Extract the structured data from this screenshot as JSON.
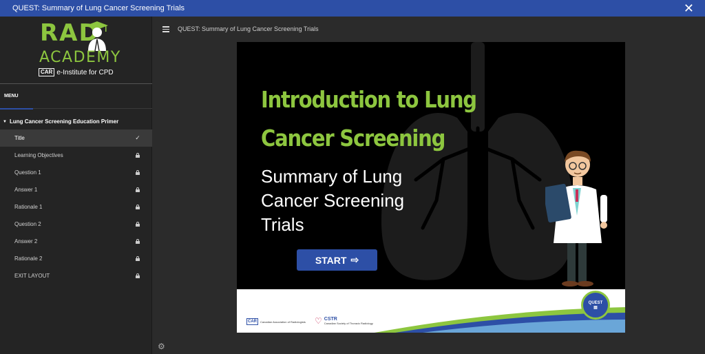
{
  "window": {
    "title": "QUEST: Summary of Lung Cancer Screening Trials"
  },
  "logo": {
    "line1": "RAD",
    "line2": "ACADEMY",
    "tag_box": "CAR",
    "tagline": "e-Institute for CPD"
  },
  "sidebar": {
    "menu_label": "MENU",
    "section_title": "Lung Cancer Screening Education Primer",
    "items": [
      {
        "label": "Title",
        "status": "completed"
      },
      {
        "label": "Learning Objectives",
        "status": "locked"
      },
      {
        "label": "Question 1",
        "status": "locked"
      },
      {
        "label": "Answer 1",
        "status": "locked"
      },
      {
        "label": "Rationale 1",
        "status": "locked"
      },
      {
        "label": "Question 2",
        "status": "locked"
      },
      {
        "label": "Answer 2",
        "status": "locked"
      },
      {
        "label": "Rationale 2",
        "status": "locked"
      },
      {
        "label": "EXIT LAYOUT",
        "status": "locked"
      }
    ],
    "check_glyph": "✓"
  },
  "topbar": {
    "breadcrumb": "QUEST: Summary of Lung Cancer Screening Trials"
  },
  "slide": {
    "heading": "Introduction to Lung Cancer Screening",
    "subheading": "Summary of Lung Cancer Screening Trials",
    "start_label": "START",
    "start_arrow": "⇨",
    "footer": {
      "car_box": "CAR",
      "car_text": "Canadian Association of Radiologists",
      "cstr_name": "CSTR",
      "cstr_text": "Canadian Society of Thoracic Radiology",
      "badge_text": "QUEST"
    }
  },
  "colors": {
    "accent_blue": "#2d4fa6",
    "accent_green": "#8dc63f",
    "sidebar_bg": "#242424",
    "content_bg": "#2b2b2b"
  }
}
